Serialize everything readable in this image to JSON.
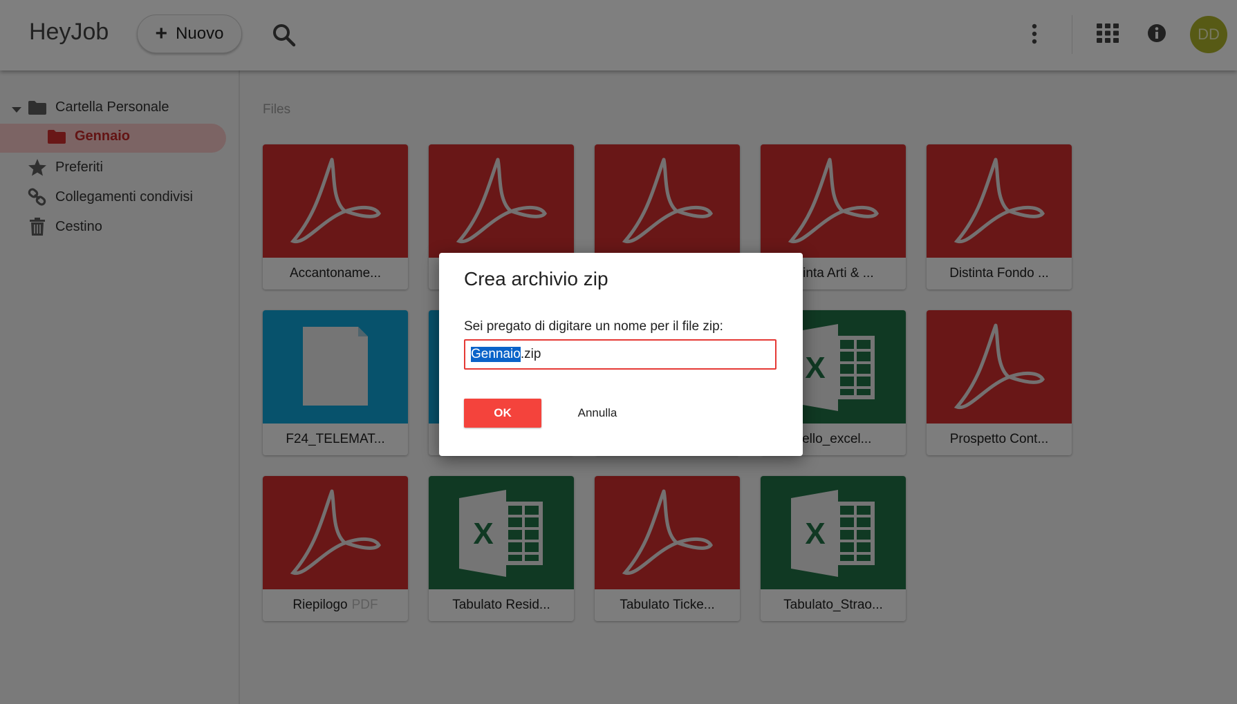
{
  "header": {
    "logo": "HeyJob",
    "new_button": "Nuovo",
    "avatar_initials": "DD"
  },
  "sidebar": {
    "items": [
      {
        "label": "Cartella Personale",
        "icon": "folder-icon"
      },
      {
        "label": "Gennaio",
        "icon": "folder-icon",
        "selected": true
      },
      {
        "label": "Preferiti",
        "icon": "star-icon"
      },
      {
        "label": "Collegamenti condivisi",
        "icon": "link-icon"
      },
      {
        "label": "Cestino",
        "icon": "trash-icon"
      }
    ]
  },
  "main": {
    "section_title": "Files",
    "files": [
      {
        "name": "Accantoname...",
        "type": "pdf"
      },
      {
        "name": "",
        "type": "pdf"
      },
      {
        "name": "",
        "type": "pdf"
      },
      {
        "name": "stinta Arti & ...",
        "type": "pdf"
      },
      {
        "name": "Distinta Fondo ...",
        "type": "pdf"
      },
      {
        "name": "F24_TELEMAT...",
        "type": "doc"
      },
      {
        "name": "",
        "type": "doc"
      },
      {
        "name": "",
        "type": "xls"
      },
      {
        "name": "dello_excel...",
        "type": "xls"
      },
      {
        "name": "Prospetto Cont...",
        "type": "pdf"
      },
      {
        "name": "Riepilogo",
        "ext": "PDF",
        "type": "pdf"
      },
      {
        "name": "Tabulato Resid...",
        "type": "xls"
      },
      {
        "name": "Tabulato Ticke...",
        "type": "pdf"
      },
      {
        "name": "Tabulato_Strao...",
        "type": "xls"
      }
    ]
  },
  "dialog": {
    "title": "Crea archivio zip",
    "message": "Sei pregato di digitare un nome per il file zip:",
    "input_selected": "Gennaio",
    "input_rest": ".zip",
    "ok_label": "OK",
    "cancel_label": "Annulla"
  },
  "colors": {
    "pdf": "#d32f2f",
    "excel": "#217346",
    "document": "#0fa5d9",
    "accent": "#f4433c",
    "avatar": "#afb42b",
    "selected_nav": "#c62828"
  }
}
